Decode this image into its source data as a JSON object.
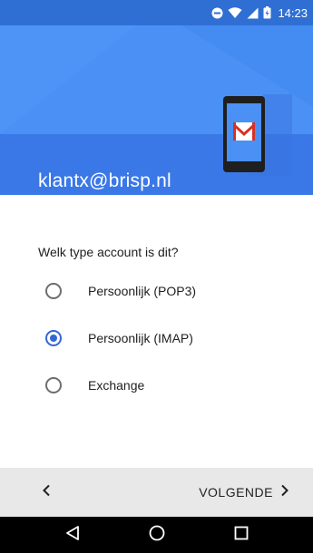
{
  "status_bar": {
    "time": "14:23",
    "icons": [
      "do-not-disturb-icon",
      "wifi-icon",
      "signal-icon",
      "battery-icon"
    ]
  },
  "header": {
    "email": "klantx@brisp.nl",
    "illustration": "gmail-phone-icon"
  },
  "form": {
    "question": "Welk type account is dit?",
    "options": [
      {
        "label": "Persoonlijk (POP3)",
        "selected": false
      },
      {
        "label": "Persoonlijk (IMAP)",
        "selected": true
      },
      {
        "label": "Exchange",
        "selected": false
      }
    ]
  },
  "footer": {
    "back_icon": "chevron-left-icon",
    "next_label": "VOLGENDE",
    "next_icon": "chevron-right-icon"
  },
  "nav": {
    "icons": [
      "nav-back-icon",
      "nav-home-icon",
      "nav-recents-icon"
    ]
  },
  "colors": {
    "status_bar": "#2f6fd3",
    "header": "#4285f4",
    "accent": "#3367d6",
    "button_bar": "#e8e8e8",
    "nav_bar": "#000000"
  }
}
